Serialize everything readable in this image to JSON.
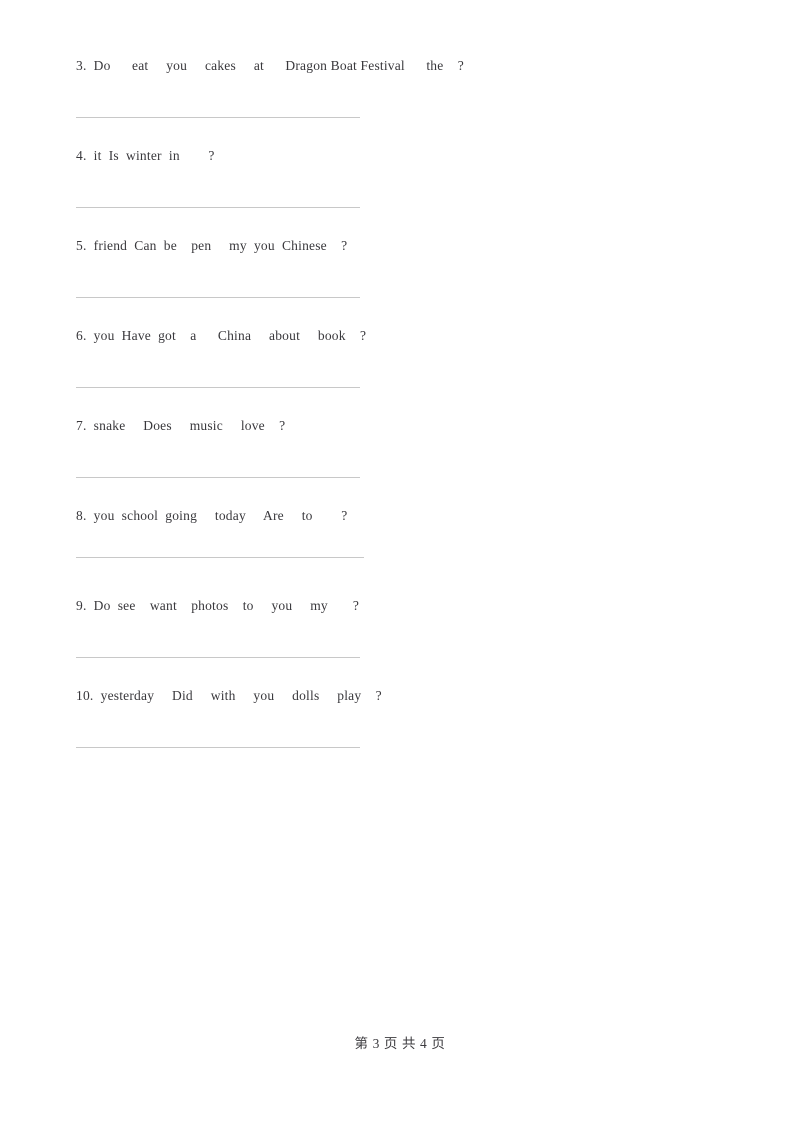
{
  "document": {
    "page_label": "第 3 页 共 4 页",
    "page_number": "3",
    "total_pages": "4",
    "background_color": "#ffffff",
    "text_color": "#39383c",
    "rule_color": "#c8c8c8"
  },
  "exercises": [
    {
      "number": "3.",
      "text": "3.  Do      eat     you     cakes     at      Dragon Boat Festival      the    ?",
      "words": [
        "Do",
        "eat",
        "you",
        "cakes",
        "at",
        "Dragon Boat Festival",
        "the",
        "?"
      ],
      "rule_width": 284
    },
    {
      "number": "4.",
      "text": "4.  it  Is  winter  in        ?",
      "words": [
        "it",
        "Is",
        "winter",
        "in",
        "?"
      ],
      "rule_width": 284
    },
    {
      "number": "5.",
      "text": "5.  friend  Can  be    pen     my  you  Chinese    ?",
      "words": [
        "friend",
        "Can",
        "be",
        "pen",
        "my",
        "you",
        "Chinese",
        "?"
      ],
      "rule_width": 284
    },
    {
      "number": "6.",
      "text": "6.  you  Have  got    a      China     about     book    ?",
      "words": [
        "you",
        "Have",
        "got",
        "a",
        "China",
        "about",
        "book",
        "?"
      ],
      "rule_width": 284
    },
    {
      "number": "7.",
      "text": "7.  snake     Does     music     love    ?",
      "words": [
        "snake",
        "Does",
        "music",
        "love",
        "?"
      ],
      "rule_width": 284
    },
    {
      "number": "8.",
      "text": "8.  you  school  going     today     Are     to        ?",
      "words": [
        "you",
        "school",
        "going",
        "today",
        "Are",
        "to",
        "?"
      ],
      "rule_width": 288
    },
    {
      "number": "9.",
      "text": "9.  Do  see    want    photos    to     you     my       ?",
      "words": [
        "Do",
        "see",
        "want",
        "photos",
        "to",
        "you",
        "my",
        "?"
      ],
      "rule_width": 284
    },
    {
      "number": "10.",
      "text": "10.  yesterday     Did     with     you     dolls     play    ?",
      "words": [
        "yesterday",
        "Did",
        "with",
        "you",
        "dolls",
        "play",
        "?"
      ],
      "rule_width": 284
    }
  ]
}
